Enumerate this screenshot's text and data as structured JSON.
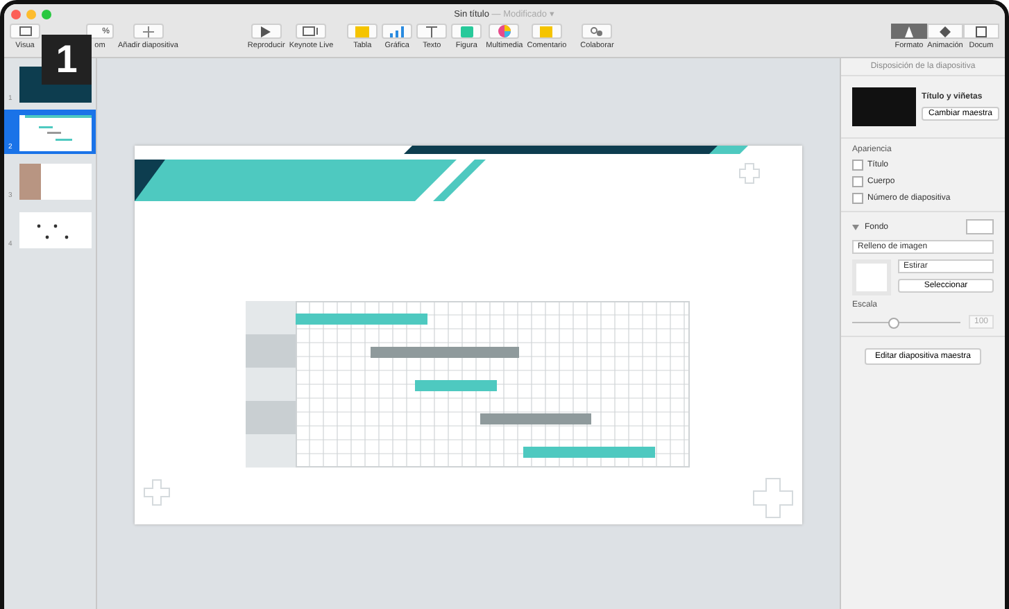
{
  "window": {
    "title": "Sin título",
    "subtitle": "— Modificado ▾"
  },
  "step_badge": "1",
  "toolbar": {
    "left": [
      {
        "kind": "view",
        "label": "Visua"
      },
      {
        "kind": "zoom",
        "label": "om",
        "value": "%"
      },
      {
        "kind": "add",
        "label": "Añadir diapositiva"
      }
    ],
    "center": [
      {
        "kind": "play",
        "label": "Reproducir"
      },
      {
        "kind": "live",
        "label": "Keynote Live"
      }
    ],
    "insert": [
      {
        "kind": "table",
        "label": "Tabla"
      },
      {
        "kind": "chart",
        "label": "Gráfica"
      },
      {
        "kind": "text",
        "label": "Texto"
      },
      {
        "kind": "shape",
        "label": "Figura"
      },
      {
        "kind": "media",
        "label": "Multimedia"
      },
      {
        "kind": "comment",
        "label": "Comentario"
      }
    ],
    "collab": {
      "label": "Colaborar"
    },
    "inspector_tabs": [
      {
        "kind": "format",
        "label": "Formato",
        "selected": true
      },
      {
        "kind": "animate",
        "label": "Animación",
        "selected": false
      },
      {
        "kind": "document",
        "label": "Docum",
        "selected": false
      }
    ]
  },
  "slides": [
    {
      "number": "1",
      "kind": "dark",
      "selected": false
    },
    {
      "number": "2",
      "kind": "gantt",
      "selected": true
    },
    {
      "number": "3",
      "kind": "photo",
      "selected": false
    },
    {
      "number": "4",
      "kind": "dots",
      "selected": false
    }
  ],
  "panel": {
    "header": "Disposición de la diapositiva",
    "master_name": "Título y viñetas",
    "change_master": "Cambiar maestra",
    "appearance_label": "Apariencia",
    "checkboxes": [
      {
        "label": "Título",
        "checked": false
      },
      {
        "label": "Cuerpo",
        "checked": false
      },
      {
        "label": "Número de diapositiva",
        "checked": false
      }
    ],
    "background": {
      "label": "Fondo",
      "expanded": true,
      "fill": "Relleno de imagen",
      "scale_mode": "Estirar",
      "select": "Seleccionar"
    },
    "scale": {
      "label": "Escala",
      "level": 0.38,
      "value": "100"
    },
    "edit_master": "Editar diapositiva maestra"
  }
}
